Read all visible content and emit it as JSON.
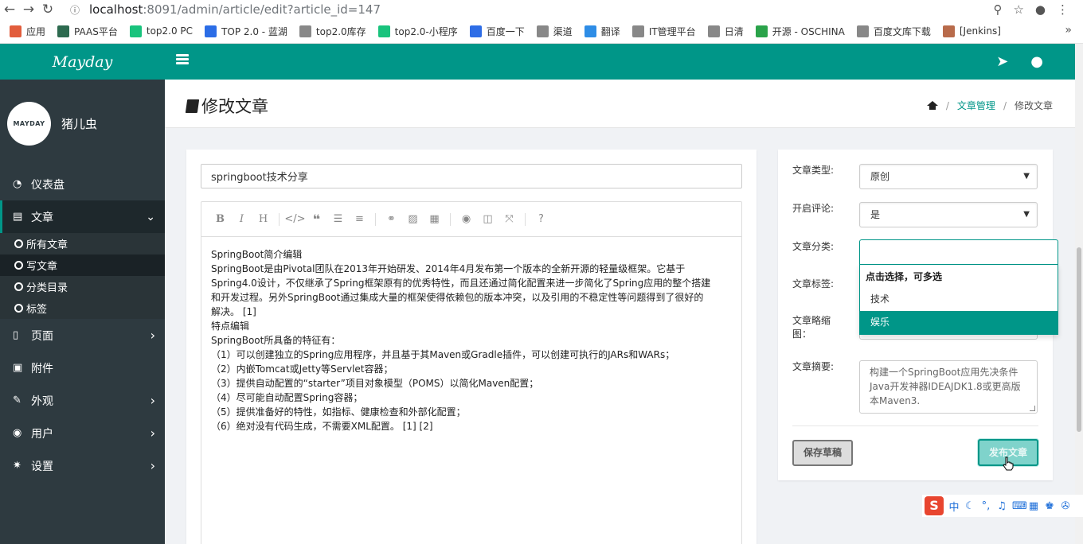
{
  "browser": {
    "url_host": "localhost",
    "url_path": ":8091/admin/article/edit?article_id=147",
    "bookmarks": [
      {
        "label": "应用",
        "color": "#e25d3c"
      },
      {
        "label": "PAAS平台",
        "color": "#2d6a4f"
      },
      {
        "label": "top2.0 PC",
        "color": "#19c37d"
      },
      {
        "label": "TOP 2.0 - 蓝湖",
        "color": "#2b6de6"
      },
      {
        "label": "top2.0库存",
        "color": "#888888"
      },
      {
        "label": "top2.0-小程序",
        "color": "#19c37d"
      },
      {
        "label": "百度一下",
        "color": "#2e6de6"
      },
      {
        "label": "渠道",
        "color": "#888888"
      },
      {
        "label": "翻译",
        "color": "#2e8de6"
      },
      {
        "label": "IT管理平台",
        "color": "#888888"
      },
      {
        "label": "日清",
        "color": "#888888"
      },
      {
        "label": "开源 - OSCHINA",
        "color": "#2aa34a"
      },
      {
        "label": "百度文库下载",
        "color": "#888888"
      },
      {
        "label": "[Jenkins]",
        "color": "#b86b4b"
      }
    ]
  },
  "sidebar": {
    "brand": "Mayday",
    "avatar_text": "MAYDAY",
    "username": "猪儿虫",
    "menu": [
      {
        "label": "仪表盘",
        "icon": "dashboard-icon",
        "glyph": "◔",
        "has_chevron": false
      },
      {
        "label": "文章",
        "icon": "book-icon",
        "glyph": "▤",
        "has_chevron": true,
        "active": true
      },
      {
        "label": "页面",
        "icon": "file-icon",
        "glyph": "▯",
        "has_chevron": true
      },
      {
        "label": "附件",
        "icon": "picture-icon",
        "glyph": "▣",
        "has_chevron": false
      },
      {
        "label": "外观",
        "icon": "brush-icon",
        "glyph": "✎",
        "has_chevron": true
      },
      {
        "label": "用户",
        "icon": "user-circle-icon",
        "glyph": "◉",
        "has_chevron": true
      },
      {
        "label": "设置",
        "icon": "gear-icon",
        "glyph": "✷",
        "has_chevron": true
      }
    ],
    "submenu": [
      {
        "label": "所有文章"
      },
      {
        "label": "写文章",
        "current": true
      },
      {
        "label": "分类目录"
      },
      {
        "label": "标签"
      }
    ]
  },
  "header": {
    "page_title": "修改文章",
    "breadcrumb": {
      "section": "文章管理",
      "current": "修改文章"
    }
  },
  "editor": {
    "title_value": "springboot技术分享",
    "content_lines": [
      "SpringBoot简介编辑",
      "SpringBoot是由Pivotal团队在2013年开始研发、2014年4月发布第一个版本的全新开源的轻量级框架。它基于",
      "Spring4.0设计，不仅继承了Spring框架原有的优秀特性，而且还通过简化配置来进一步简化了Spring应用的整个搭建",
      "和开发过程。另外SpringBoot通过集成大量的框架使得依赖包的版本冲突，以及引用的不稳定性等问题得到了很好的",
      "解决。 [1]",
      "特点编辑",
      "SpringBoot所具备的特征有：",
      "（1）可以创建独立的Spring应用程序，并且基于其Maven或Gradle插件，可以创建可执行的JARs和WARs；",
      "（2）内嵌Tomcat或Jetty等Servlet容器；",
      "（3）提供自动配置的“starter”项目对象模型（POMS）以简化Maven配置；",
      "（4）尽可能自动配置Spring容器；",
      "（5）提供准备好的特性，如指标、健康检查和外部化配置；",
      "（6）绝对没有代码生成，不需要XML配置。 [1]  [2]"
    ]
  },
  "settings": {
    "type_label": "文章类型:",
    "type_value": "原创",
    "comment_label": "开启评论:",
    "comment_value": "是",
    "category_label": "文章分类:",
    "category_hint": "点击选择，可多选",
    "category_options": [
      "技术",
      "娱乐"
    ],
    "tags_label": "文章标签:",
    "thumb_label": "文章略缩图：",
    "summary_label": "文章摘要:",
    "summary_value": "构建一个SpringBoot应用先决条件Java开发神器IDEAJDK1.8或更高版本Maven3.",
    "draft_button": "保存草稿",
    "publish_button": "发布文章"
  },
  "ime": {
    "logo": "S",
    "mode": "中"
  },
  "colors": {
    "accent": "#009688",
    "sidebar": "#2e3a40"
  }
}
